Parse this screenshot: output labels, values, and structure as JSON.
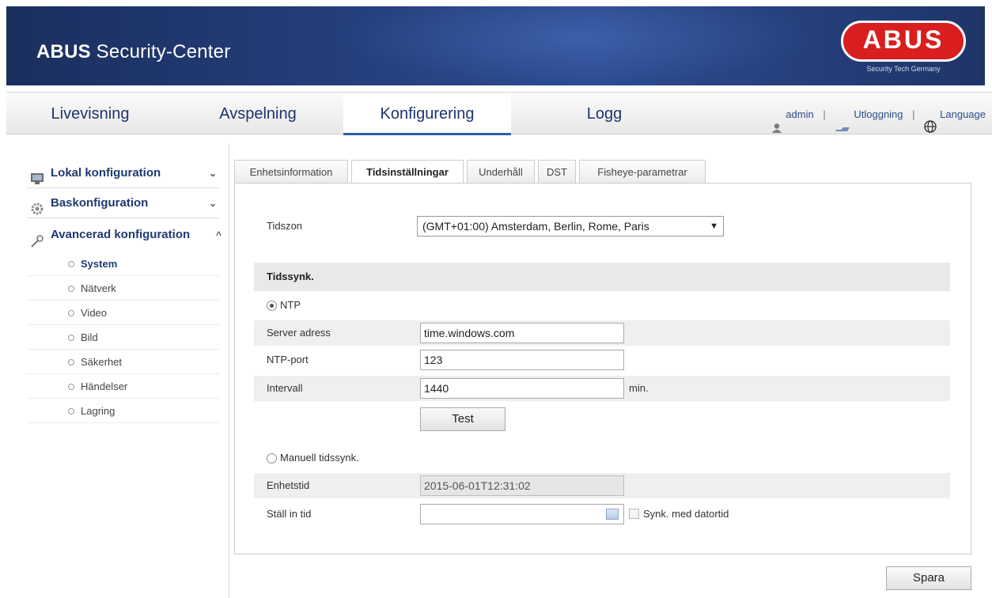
{
  "header": {
    "brand_bold": "ABUS",
    "brand_rest": " Security-Center",
    "logo_text": "ABUS",
    "logo_tagline": "Security Tech Germany"
  },
  "nav": {
    "items": [
      {
        "label": "Livevisning"
      },
      {
        "label": "Avspelning"
      },
      {
        "label": "Konfigurering",
        "active": true
      },
      {
        "label": "Logg"
      }
    ],
    "user": "admin",
    "logout": "Utloggning",
    "language": "Language",
    "separator": "|"
  },
  "sidebar": {
    "sections": [
      {
        "label": "Lokal konfiguration",
        "chevron": "⌄",
        "icon": "monitor-icon"
      },
      {
        "label": "Baskonfiguration",
        "chevron": "⌄",
        "icon": "gear-icon"
      },
      {
        "label": "Avancerad konfiguration",
        "chevron": "^",
        "icon": "wrench-icon"
      }
    ],
    "items": [
      {
        "label": "System",
        "active": true
      },
      {
        "label": "Nätverk"
      },
      {
        "label": "Video"
      },
      {
        "label": "Bild"
      },
      {
        "label": "Säkerhet"
      },
      {
        "label": "Händelser"
      },
      {
        "label": "Lagring"
      }
    ]
  },
  "tabs": [
    {
      "label": "Enhetsinformation"
    },
    {
      "label": "Tidsinställningar",
      "active": true
    },
    {
      "label": "Underhåll"
    },
    {
      "label": "DST"
    },
    {
      "label": "Fisheye-parametrar"
    }
  ],
  "form": {
    "timezone_label": "Tidszon",
    "timezone_value": "(GMT+01:00) Amsterdam, Berlin, Rome, Paris",
    "sync_title": "Tidssynk.",
    "ntp_label": "NTP",
    "server_label": "Server adress",
    "server_value": "time.windows.com",
    "port_label": "NTP-port",
    "port_value": "123",
    "interval_label": "Intervall",
    "interval_value": "1440",
    "interval_unit": "min.",
    "test_button": "Test",
    "manual_label": "Manuell tidssynk.",
    "device_time_label": "Enhetstid",
    "device_time_value": "2015-06-01T12:31:02",
    "set_time_label": "Ställ in tid",
    "set_time_value": "",
    "sync_pc_label": "Synk. med datortid"
  },
  "save_button": "Spara",
  "colors": {
    "banner": "#243f7c",
    "nav_text": "#1c3470",
    "logo_red": "#d81e1e"
  }
}
